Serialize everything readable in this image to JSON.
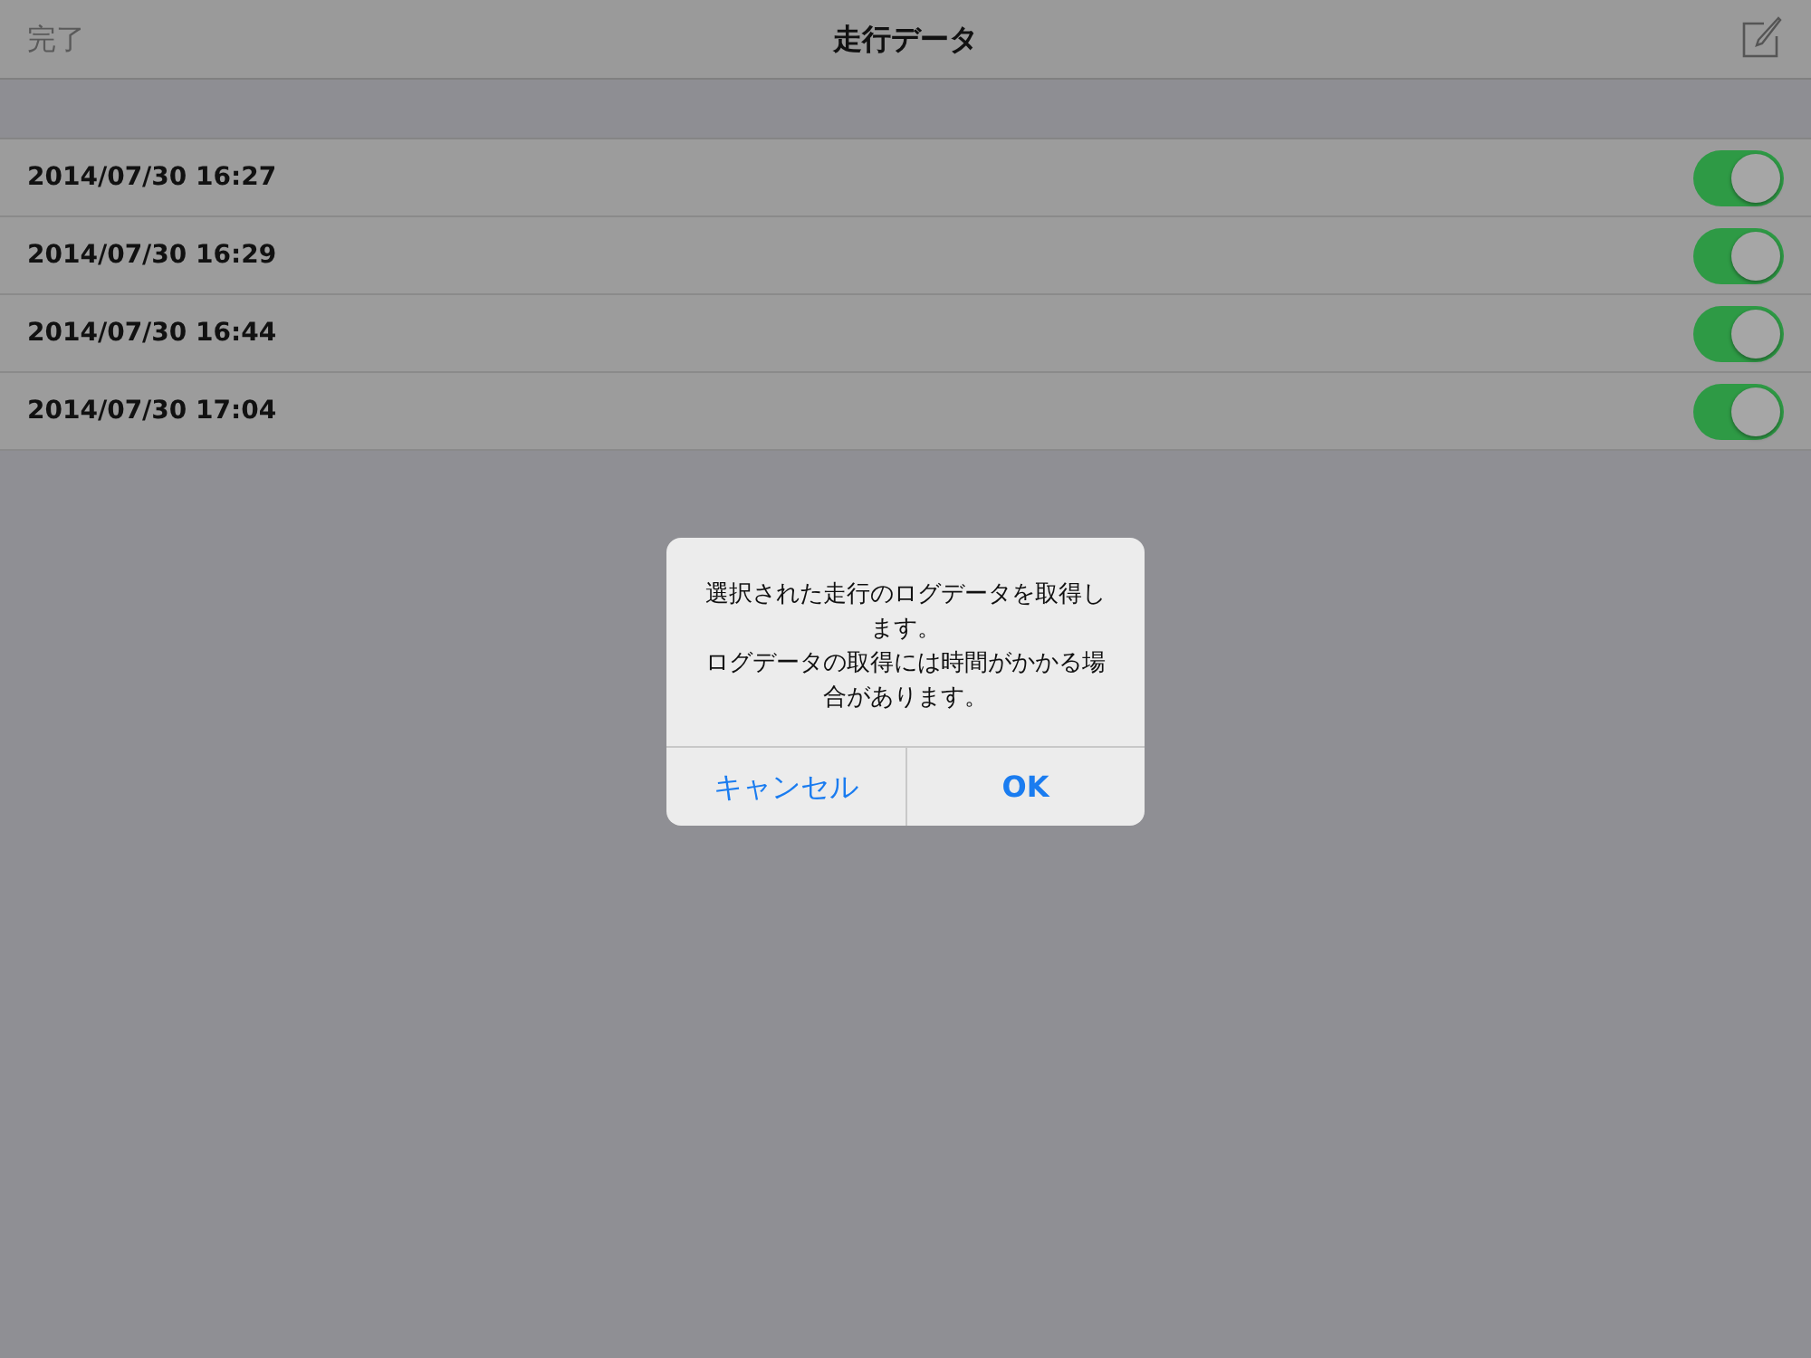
{
  "nav_bar": {
    "left_button": "完了",
    "title": "走行データ"
  },
  "rows": [
    {
      "label": "2014/07/30 16:27",
      "on": true
    },
    {
      "label": "2014/07/30 16:29",
      "on": true
    },
    {
      "label": "2014/07/30 16:44",
      "on": true
    },
    {
      "label": "2014/07/30 17:04",
      "on": true
    }
  ],
  "alert": {
    "messages": [
      "選択された走行のログデータを取得します。",
      "ログデータの取得には時間がかかる場合があります。"
    ],
    "buttons": [
      {
        "label": "キャンセル",
        "kind": "cancel"
      },
      {
        "label": "OK",
        "kind": "default"
      }
    ]
  }
}
